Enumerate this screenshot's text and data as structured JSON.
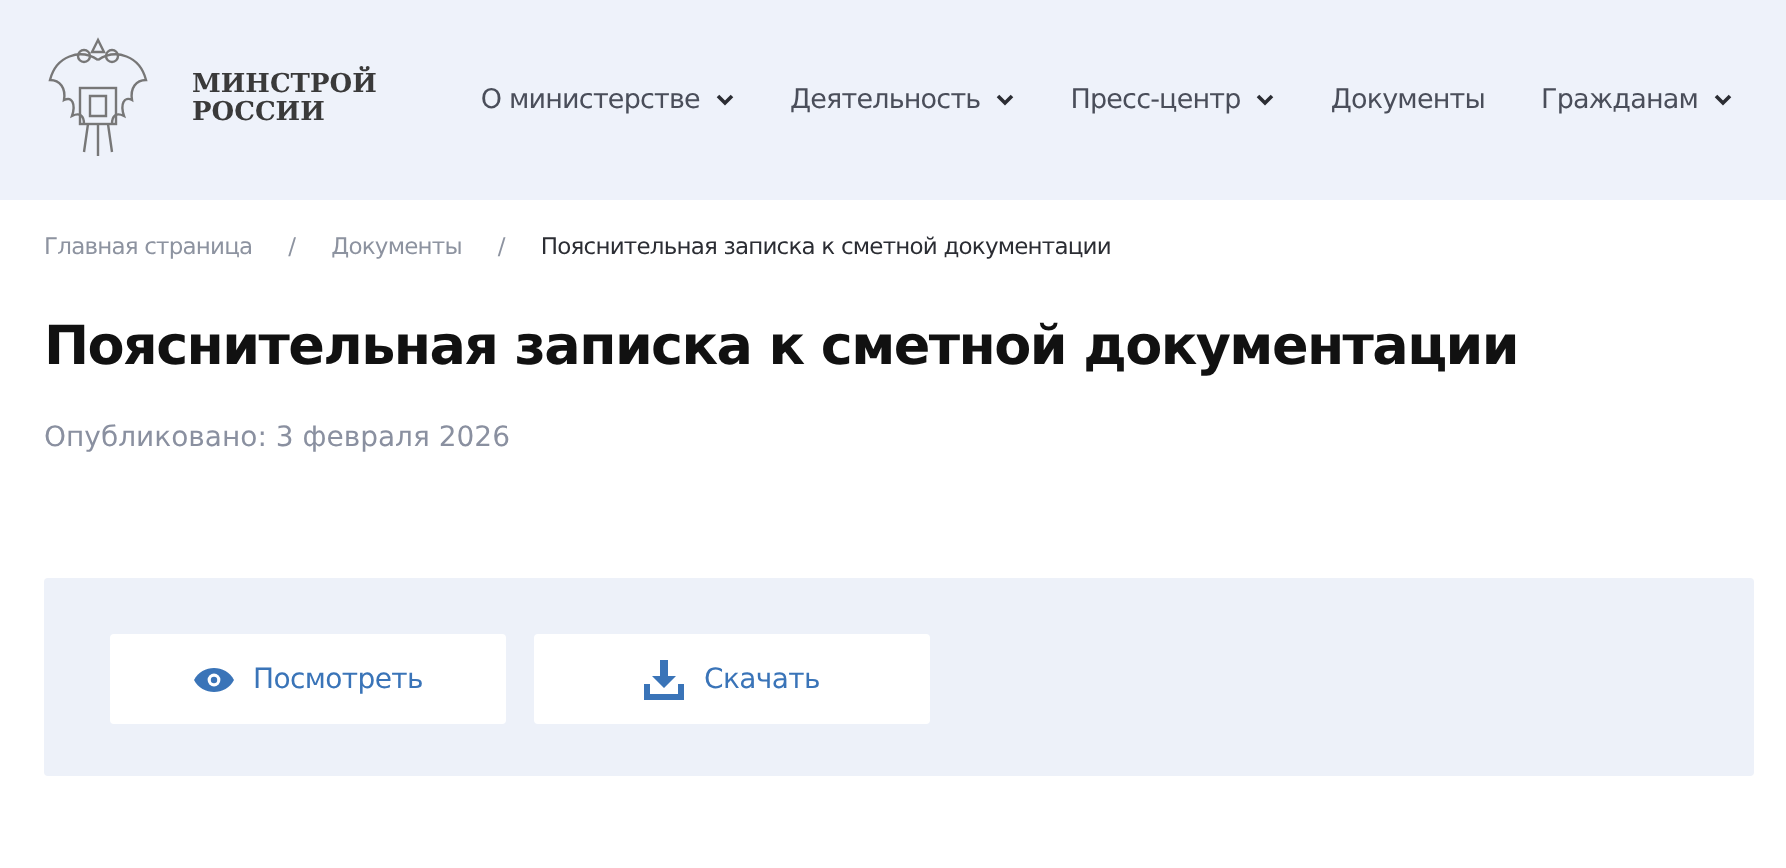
{
  "logo": {
    "line_1": "МИНСТРОЙ",
    "line_2": "РОССИИ"
  },
  "nav": [
    {
      "label": "О министерстве",
      "dropdown": true
    },
    {
      "label": "Деятельность",
      "dropdown": true
    },
    {
      "label": "Пресс-центр",
      "dropdown": true
    },
    {
      "label": "Документы",
      "dropdown": false
    },
    {
      "label": "Гражданам",
      "dropdown": true
    }
  ],
  "breadcrumbs": [
    {
      "label": "Главная страница",
      "current": false
    },
    {
      "label": "Документы",
      "current": false
    },
    {
      "label": "Пояснительная записка к сметной документации",
      "current": true
    }
  ],
  "breadcrumb_separator": "/",
  "title": "Пояснительная записка к сметной документации",
  "published": "Опубликовано: 3 февраля 2026",
  "actions": [
    {
      "kind": "view",
      "label": "Посмотреть"
    },
    {
      "kind": "download",
      "label": "Скачать"
    }
  ]
}
